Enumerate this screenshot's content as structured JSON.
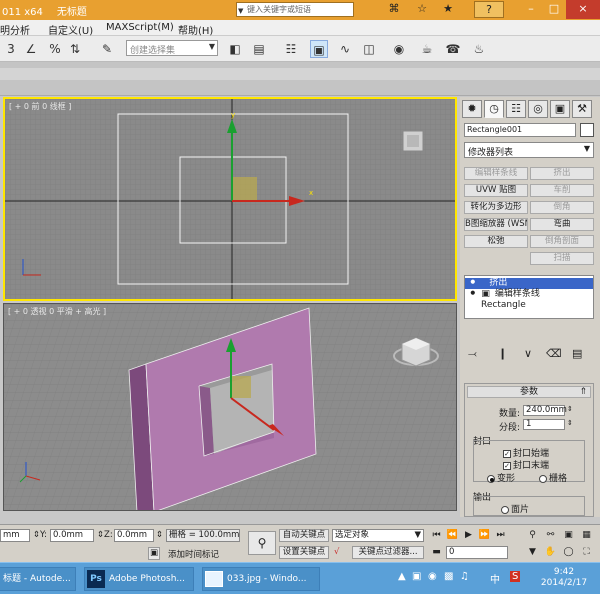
{
  "titlebar": {
    "app_fragment": "011 x64",
    "doc_title": "无标题",
    "search_placeholder": "键入关键字或短语",
    "search_tools": [
      "⌘",
      "☆",
      "★"
    ],
    "help_label": "?",
    "win_buttons": [
      "–",
      "□",
      "×"
    ]
  },
  "menubar": {
    "items": [
      "明分析",
      "自定义(U)",
      "MAXScript(M)",
      "帮助(H)"
    ]
  },
  "toolbar": {
    "selection_set_placeholder": "创建选择集",
    "dropdown_arrow": "▼"
  },
  "viewport_top": {
    "label": "[ + 0 前 0 线框 ]"
  },
  "viewport_persp": {
    "label": "[ + 0 透视 0 平滑 + 高光 ]"
  },
  "command_panel": {
    "object_name": "Rectangle001",
    "modifier_list": "修改器列表",
    "modifier_buttons": [
      {
        "label": "编辑样条线",
        "enabled": false
      },
      {
        "label": "挤出",
        "enabled": false
      },
      {
        "label": "UVW 贴图",
        "enabled": true
      },
      {
        "label": "车削",
        "enabled": false
      },
      {
        "label": "转化为多边形",
        "enabled": true
      },
      {
        "label": "倒角",
        "enabled": false
      },
      {
        "label": "B图缩放器 (WSM",
        "enabled": true
      },
      {
        "label": "弯曲",
        "enabled": true
      },
      {
        "label": "松弛",
        "enabled": true
      },
      {
        "label": "倒角剖面",
        "enabled": false
      },
      {
        "label": "扫描",
        "enabled": false
      }
    ],
    "stack": [
      {
        "label": "挤出",
        "selected": true
      },
      {
        "label": "编辑样条线",
        "selected": false
      },
      {
        "label": "Rectangle",
        "selected": false
      }
    ],
    "params": {
      "rollout_title": "参数",
      "amount_label": "数量:",
      "amount_value": "240.0mm",
      "segments_label": "分段:",
      "segments_value": "1",
      "capping_label": "封口",
      "cap_start_label": "封口始端",
      "cap_end_label": "封口末端",
      "morph_label": "变形",
      "grid_label": "栅格",
      "output_label": "输出",
      "patch_label": "面片"
    }
  },
  "statusbar": {
    "x_value": "mm",
    "y_label": "Y:",
    "y_value": "0.0mm",
    "z_label": "Z:",
    "z_value": "0.0mm",
    "grid_label": "栅格 = 100.0mm",
    "add_time_tag": "添加时间标记",
    "auto_key": "自动关键点",
    "set_key": "设置关键点",
    "selection_mode": "选定对象",
    "key_filters": "关键点过滤器...",
    "frame_value": "0"
  },
  "taskbar": {
    "items": [
      {
        "label": "标题 - Autode..."
      },
      {
        "label": "Adobe Photosh..."
      },
      {
        "label": "033.jpg - Windo..."
      }
    ],
    "tray_lang": "中",
    "tray_s": "S",
    "time": "9:42",
    "date": "2014/2/17"
  }
}
